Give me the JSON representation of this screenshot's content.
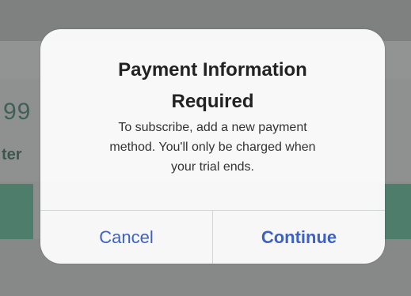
{
  "background": {
    "price_fragment": "99",
    "subtitle_fragment": "ter"
  },
  "alert": {
    "title_line1": "Payment Information",
    "title_line2": "Required",
    "message_line1": "To subscribe, add a new payment",
    "message_line2": "method. You'll only be charged when",
    "message_line3": "your trial ends.",
    "cancel_label": "Cancel",
    "continue_label": "Continue"
  },
  "colors": {
    "button_text": "#3b62c4",
    "background_accent": "#4e7d6c"
  }
}
